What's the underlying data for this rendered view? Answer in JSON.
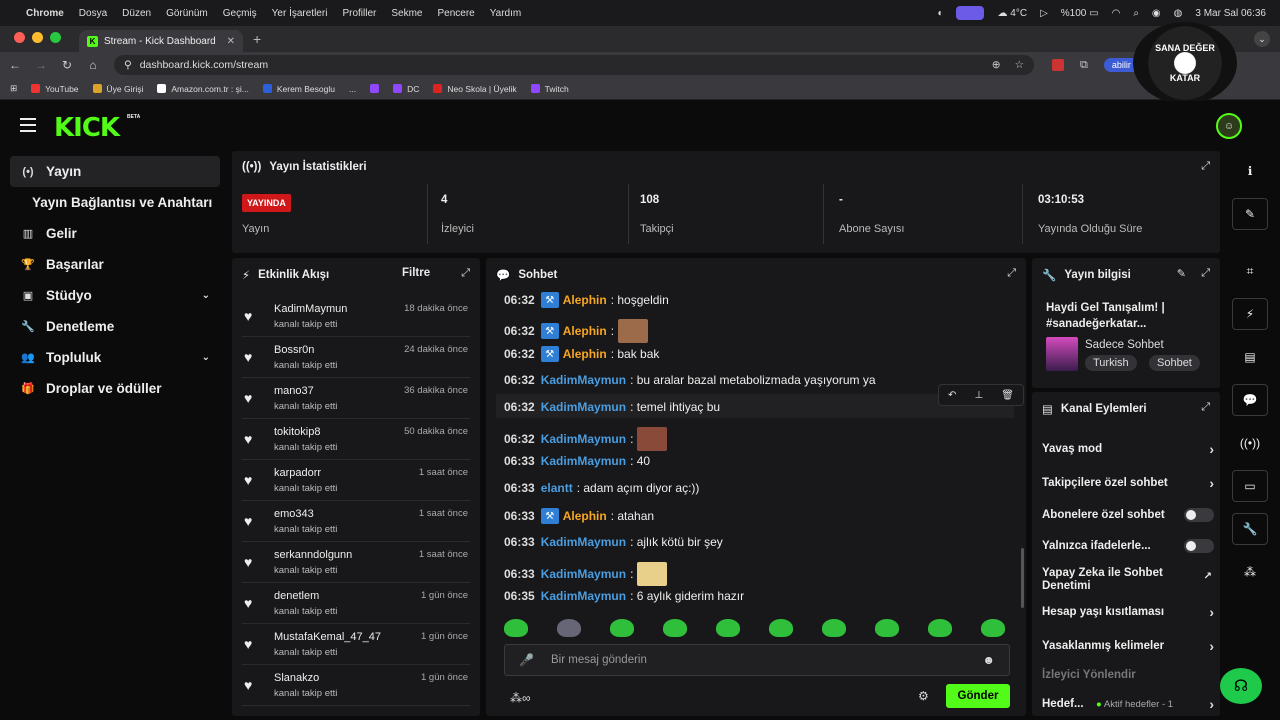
{
  "macbar": {
    "app": "Chrome",
    "menus": [
      "Dosya",
      "Düzen",
      "Görünüm",
      "Geçmiş",
      "Yer İşaretleri",
      "Profiller",
      "Sekme",
      "Pencere",
      "Yardım"
    ],
    "temp": "4°C",
    "battery": "%100",
    "datetime": "3 Mar Sal 06:36"
  },
  "tab": {
    "title": "Stream - Kick Dashboard"
  },
  "url": "dashboard.kick.com/stream",
  "profile_btn": "abilir",
  "bookmarks": [
    "YouTube",
    "Üye Girişi",
    "Amazon.com.tr : şi...",
    "Kerem Besoglu",
    "...",
    "DC",
    "Neo Skola | Üyelik",
    "Twitch"
  ],
  "watermark": {
    "line1": "SANA DEĞER",
    "line2": "KATAR"
  },
  "brand": {
    "logo": "KICK",
    "beta": "BETA"
  },
  "sidebar": [
    {
      "label": "Yayın",
      "icon": "broadcast-icon"
    },
    {
      "label": "Yayın Bağlantısı ve Anahtarı"
    },
    {
      "label": "Gelir",
      "icon": "chart-icon"
    },
    {
      "label": "Başarılar",
      "icon": "trophy-icon"
    },
    {
      "label": "Stüdyo",
      "icon": "studio-icon",
      "chevron": "❯"
    },
    {
      "label": "Denetleme",
      "icon": "wrench-icon"
    },
    {
      "label": "Topluluk",
      "icon": "people-icon",
      "chevron": "❯"
    },
    {
      "label": "Droplar ve ödüller",
      "icon": "gift-icon"
    }
  ],
  "stats": {
    "title": "Yayın İstatistikleri",
    "live_badge": "YAYINDA",
    "items": [
      {
        "label": "Yayın"
      },
      {
        "value": "4",
        "label": "İzleyici"
      },
      {
        "value": "108",
        "label": "Takipçi"
      },
      {
        "value": "-",
        "label": "Abone Sayısı"
      },
      {
        "value": "03:10:53",
        "label": "Yayında Olduğu Süre"
      }
    ]
  },
  "activity": {
    "title": "Etkinlik Akışı",
    "filter": "Filtre",
    "items": [
      {
        "name": "KadimMaymun",
        "sub": "kanalı takip etti",
        "time": "18 dakika önce"
      },
      {
        "name": "Bossr0n",
        "sub": "kanalı takip etti",
        "time": "24 dakika önce"
      },
      {
        "name": "mano37",
        "sub": "kanalı takip etti",
        "time": "36 dakika önce"
      },
      {
        "name": "tokitokip8",
        "sub": "kanalı takip etti",
        "time": "50 dakika önce"
      },
      {
        "name": "karpadorr",
        "sub": "kanalı takip etti",
        "time": "1 saat önce"
      },
      {
        "name": "emo343",
        "sub": "kanalı takip etti",
        "time": "1 saat önce"
      },
      {
        "name": "serkanndolgunn",
        "sub": "kanalı takip etti",
        "time": "1 saat önce"
      },
      {
        "name": "denetlem",
        "sub": "kanalı takip etti",
        "time": "1 gün önce"
      },
      {
        "name": "MustafaKemal_47_47",
        "sub": "kanalı takip etti",
        "time": "1 gün önce"
      },
      {
        "name": "Slanakzo",
        "sub": "kanalı takip etti",
        "time": "1 gün önce"
      }
    ]
  },
  "chat": {
    "title": "Sohbet",
    "messages": [
      {
        "time": "06:32",
        "user": "Alephin",
        "color": "orange",
        "badge": true,
        "text": ": hoşgeldin"
      },
      {
        "time": "06:32",
        "user": "Alephin",
        "color": "orange",
        "badge": true,
        "text": ":",
        "emote": "#9b6b4a"
      },
      {
        "time": "06:32",
        "user": "Alephin",
        "color": "orange",
        "badge": true,
        "text": ": bak bak"
      },
      {
        "time": "06:32",
        "user": "KadimMaymun",
        "color": "blue",
        "text": ": bu aralar bazal metabolizmada yaşıyorum ya"
      },
      {
        "time": "06:32",
        "user": "KadimMaymun",
        "color": "blue",
        "text": ": temel ihtiyaç bu"
      },
      {
        "time": "06:32",
        "user": "KadimMaymun",
        "color": "blue",
        "text": ":",
        "emote": "#8a4a3a"
      },
      {
        "time": "06:33",
        "user": "KadimMaymun",
        "color": "blue",
        "text": ": 40"
      },
      {
        "time": "06:33",
        "user": "elantt",
        "color": "blue",
        "text": ": adam açım diyor aç:))"
      },
      {
        "time": "06:33",
        "user": "Alephin",
        "color": "orange",
        "badge": true,
        "text": ": atahan"
      },
      {
        "time": "06:33",
        "user": "KadimMaymun",
        "color": "blue",
        "text": ": ajlık kötü bir şey"
      },
      {
        "time": "06:33",
        "user": "KadimMaymun",
        "color": "blue",
        "text": ":",
        "emote": "#e8d08a"
      },
      {
        "time": "06:35",
        "user": "KadimMaymun",
        "color": "blue",
        "text": ": 6 aylık giderim hazır"
      }
    ],
    "tools": [
      "↶",
      "⊥",
      "🗑"
    ],
    "placeholder": "Bir mesaj gönderin",
    "send": "Gönder"
  },
  "info": {
    "title_label": "Yayın bilgisi",
    "stream_title": "Haydi Gel Tanışalım! | #sanadeğerkatar...",
    "category": "Sadece Sohbet",
    "tags": [
      "Turkish",
      "Sohbet"
    ]
  },
  "actions": {
    "title": "Kanal Eylemleri",
    "rows": [
      {
        "label": "Yavaş mod",
        "type": "chev"
      },
      {
        "label": "Takipçilere özel sohbet",
        "type": "chev"
      },
      {
        "label": "Abonelere özel sohbet",
        "type": "toggle"
      },
      {
        "label": "Yalnızca ifadelerle...",
        "type": "toggle"
      },
      {
        "label": "Yapay Zeka ile Sohbet Denetimi",
        "type": "ext"
      },
      {
        "label": "Hesap yaşı kısıtlaması",
        "type": "chev"
      },
      {
        "label": "Yasaklanmış kelimeler",
        "type": "chev"
      },
      {
        "label": "İzleyici Yönlendir",
        "type": "dim"
      },
      {
        "label": "Hedef...",
        "type": "goal",
        "extra": "Aktif hedefler - 1"
      }
    ]
  },
  "colors": {
    "brand": "#53fc18",
    "live": "#d0181a",
    "orange_user": "#f7a623",
    "blue_user": "#4a9de0"
  }
}
